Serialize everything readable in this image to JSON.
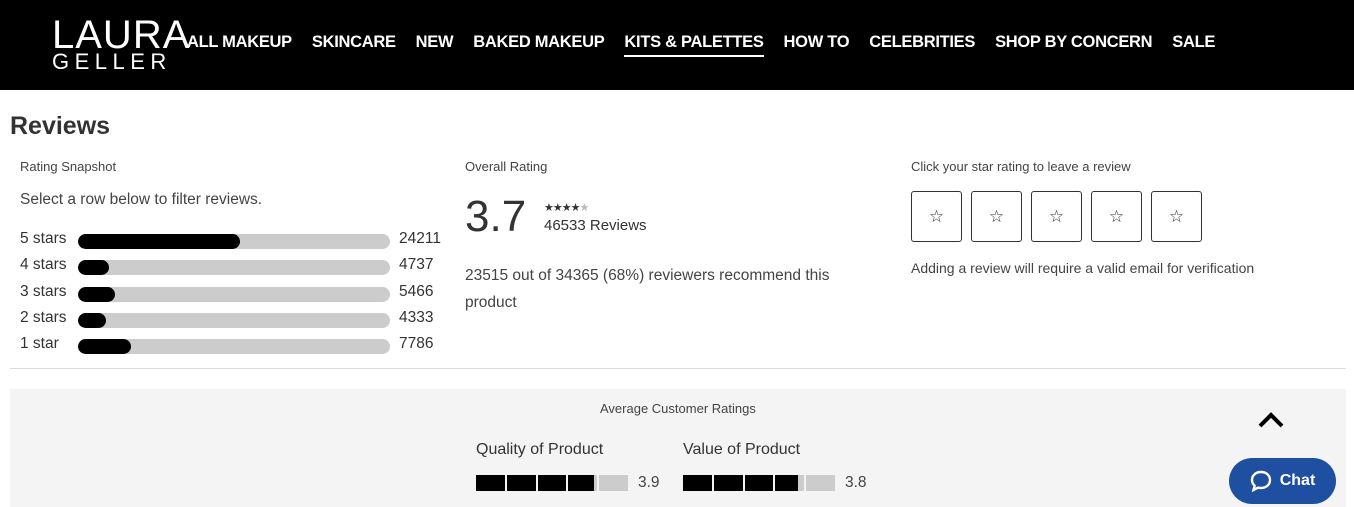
{
  "logo": {
    "line1": "LAURA",
    "line2": "GELLER"
  },
  "nav": [
    {
      "label": "ALL MAKEUP",
      "active": false
    },
    {
      "label": "SKINCARE",
      "active": false
    },
    {
      "label": "NEW",
      "active": false
    },
    {
      "label": "BAKED MAKEUP",
      "active": false
    },
    {
      "label": "KITS & PALETTES",
      "active": true
    },
    {
      "label": "HOW TO",
      "active": false
    },
    {
      "label": "CELEBRITIES",
      "active": false
    },
    {
      "label": "SHOP BY CONCERN",
      "active": false
    },
    {
      "label": "SALE",
      "active": false
    }
  ],
  "reviews": {
    "title": "Reviews",
    "snapshot": {
      "heading": "Rating Snapshot",
      "hint": "Select a row below to filter reviews.",
      "rows": [
        {
          "label": "5 stars",
          "count": "24211",
          "fraction": 0.52
        },
        {
          "label": "4 stars",
          "count": "4737",
          "fraction": 0.1
        },
        {
          "label": "3 stars",
          "count": "5466",
          "fraction": 0.12
        },
        {
          "label": "2 stars",
          "count": "4333",
          "fraction": 0.09
        },
        {
          "label": "1 star",
          "count": "7786",
          "fraction": 0.17
        }
      ]
    },
    "overall": {
      "heading": "Overall Rating",
      "rating": "3.7",
      "stars_filled": 4,
      "stars_total": 5,
      "review_count": "46533 Reviews",
      "recommend_text": "23515 out of 34365 (68%) reviewers recommend this product"
    },
    "leave_review": {
      "heading": "Click your star rating to leave a review",
      "star_count": 5,
      "star_glyph": "☆",
      "note": "Adding a review will require a valid email for verification"
    },
    "averages": {
      "heading": "Average Customer Ratings",
      "items": [
        {
          "name": "Quality of Product",
          "value": "3.9",
          "score": 3.9,
          "max": 5
        },
        {
          "name": "Value of Product",
          "value": "3.8",
          "score": 3.8,
          "max": 5
        }
      ]
    }
  },
  "chat": {
    "label": "Chat",
    "icon": "chat-bubble-icon",
    "color": "#1f4fa0"
  },
  "scroll_top": {
    "icon": "chevron-up-icon"
  }
}
